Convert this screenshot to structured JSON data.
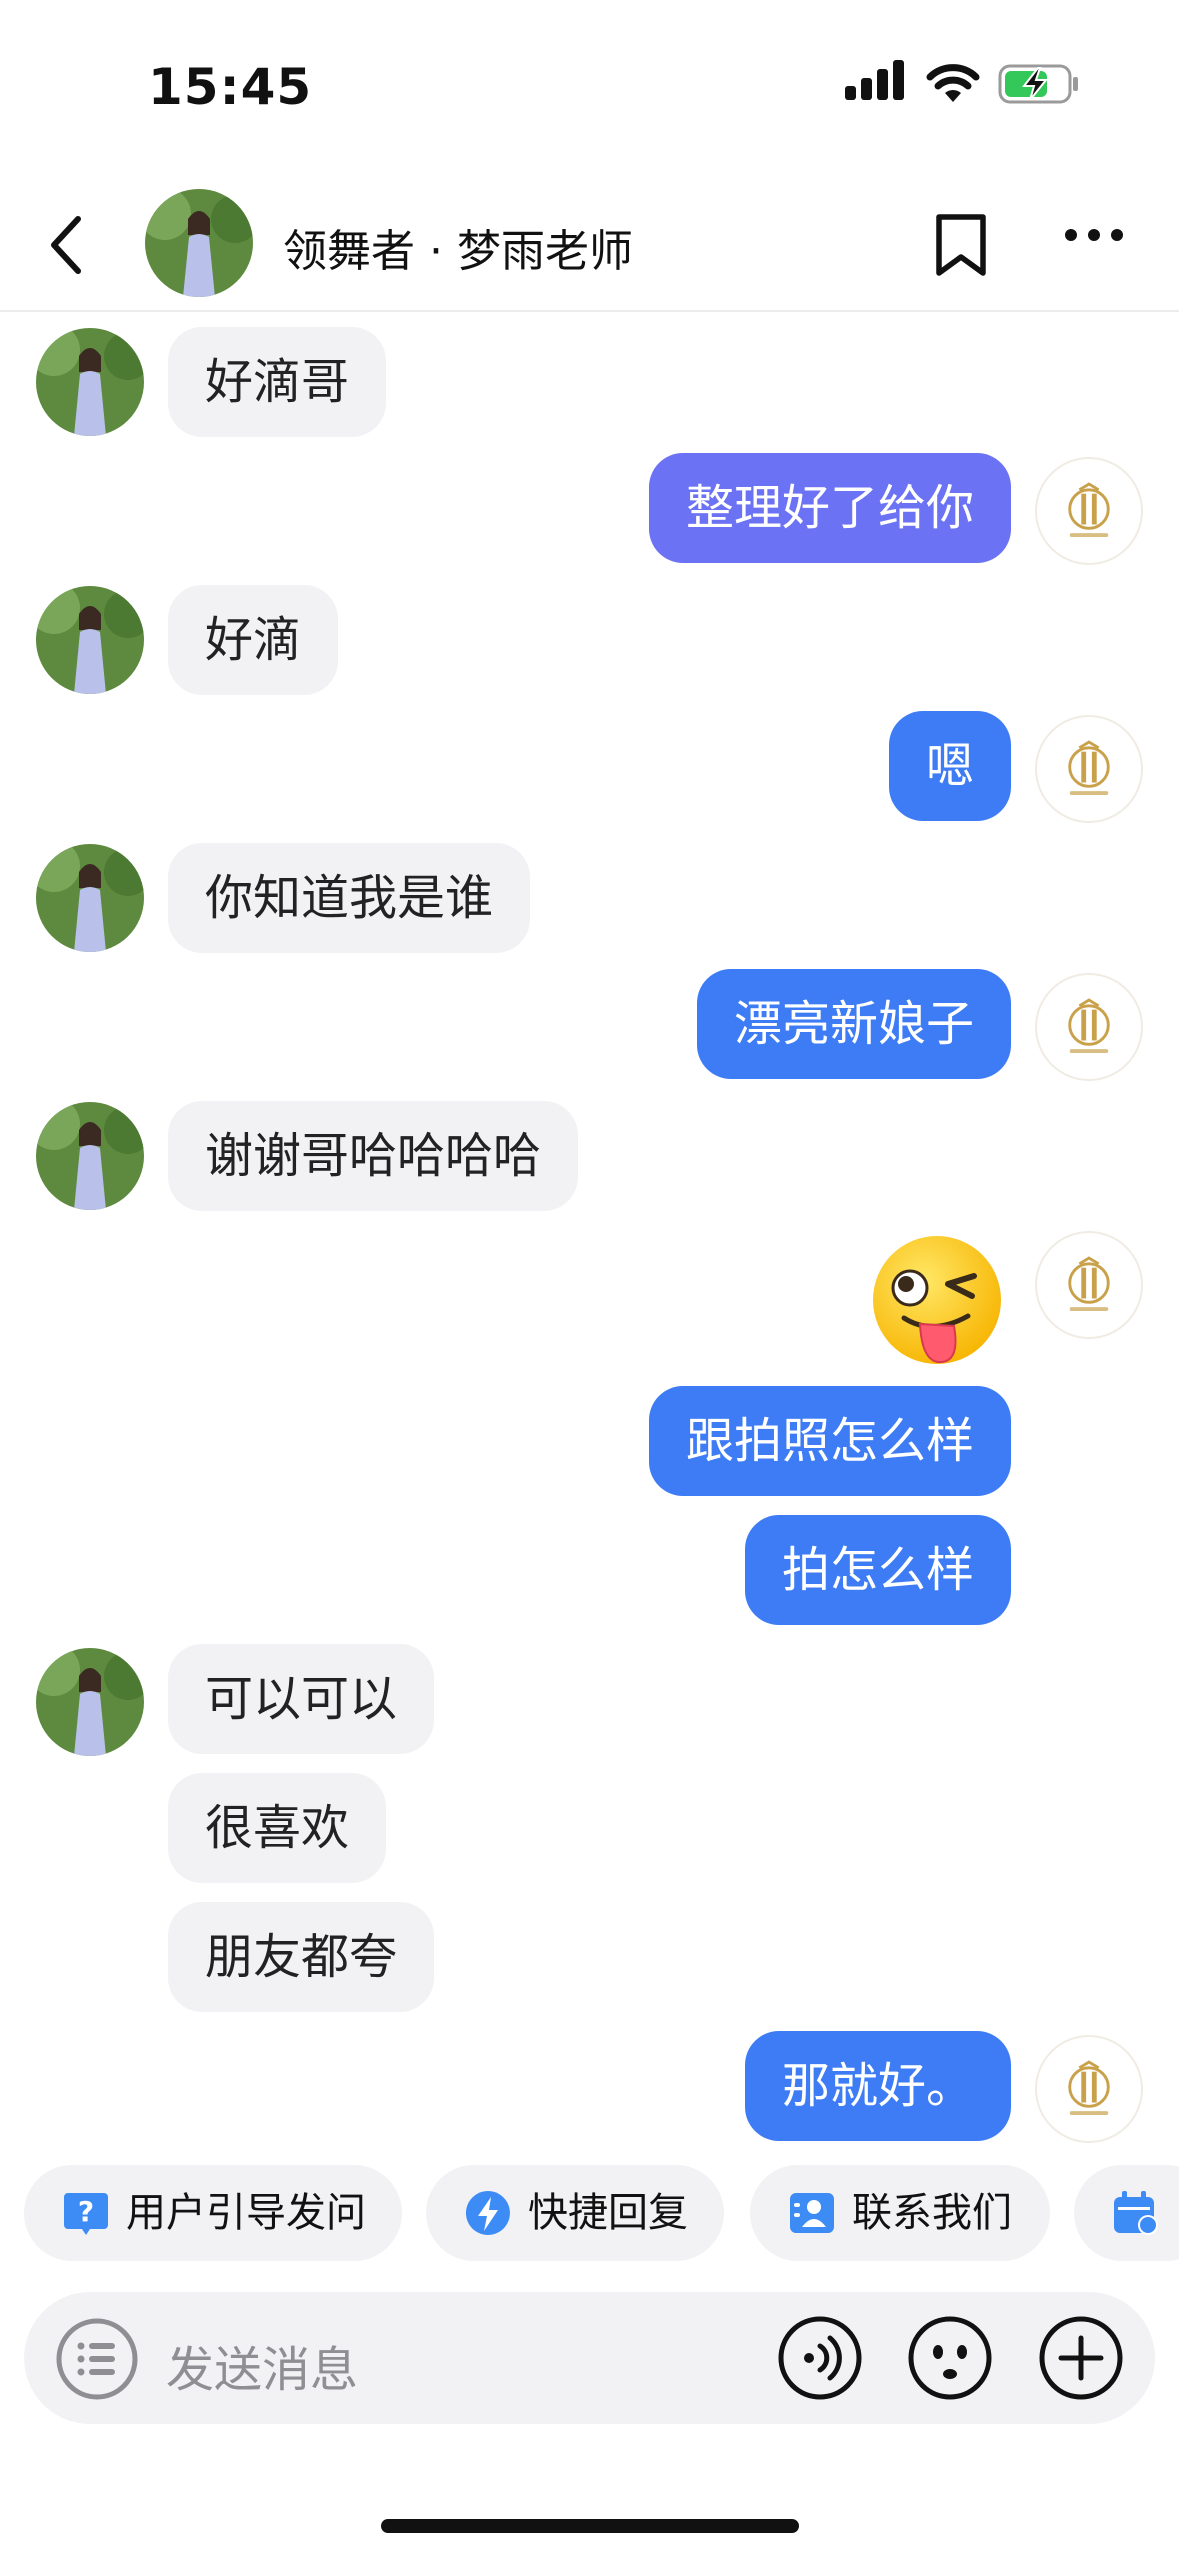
{
  "status_bar": {
    "time": "15:45"
  },
  "header": {
    "title": "领舞者 · 梦雨老师"
  },
  "messages": [
    {
      "side": "in",
      "text": "好滴哥"
    },
    {
      "side": "out",
      "text": "整理好了给你"
    },
    {
      "side": "in",
      "text": "好滴"
    },
    {
      "side": "out",
      "text": "嗯"
    },
    {
      "side": "in",
      "text": "你知道我是谁"
    },
    {
      "side": "out",
      "text": "漂亮新娘子"
    },
    {
      "side": "in",
      "text": "谢谢哥哈哈哈哈"
    },
    {
      "side": "out",
      "text": "",
      "sticker": "wink-tongue-emoji"
    },
    {
      "side": "out",
      "text": "跟拍照怎么样"
    },
    {
      "side": "out",
      "text": "拍怎么样"
    },
    {
      "side": "in",
      "text": "可以可以"
    },
    {
      "side": "in",
      "text": "很喜欢"
    },
    {
      "side": "in",
      "text": "朋友都夸"
    },
    {
      "side": "out",
      "text": "那就好。"
    }
  ],
  "quick_replies": [
    {
      "label": "用户引导发问",
      "icon": "question-icon"
    },
    {
      "label": "快捷回复",
      "icon": "lightning-icon"
    },
    {
      "label": "联系我们",
      "icon": "contacts-icon"
    },
    {
      "label": "",
      "icon": "calendar-icon"
    }
  ],
  "input": {
    "placeholder": "发送消息"
  },
  "colors": {
    "incoming_bubble": "#f2f2f5",
    "outgoing_bubble": "#3d7cf5",
    "quick_reply_icon": "#3d8bf5"
  }
}
